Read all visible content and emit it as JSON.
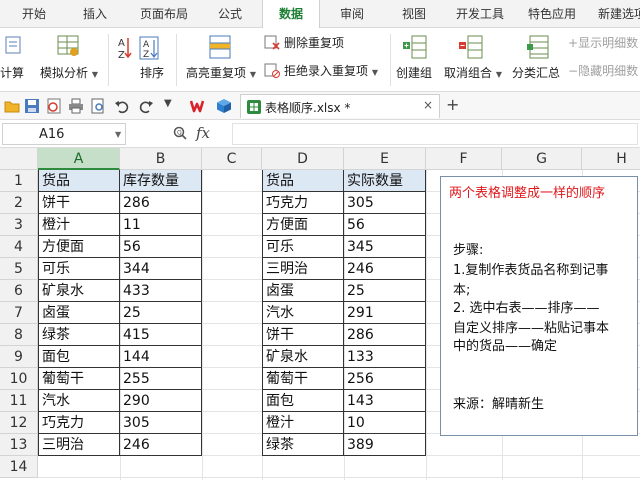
{
  "ribbon_tabs": [
    {
      "label": "开始",
      "active": false
    },
    {
      "label": "插入",
      "active": false
    },
    {
      "label": "页面布局",
      "active": false
    },
    {
      "label": "公式",
      "active": false
    },
    {
      "label": "数据",
      "active": true
    },
    {
      "label": "审阅",
      "active": false
    },
    {
      "label": "视图",
      "active": false
    },
    {
      "label": "开发工具",
      "active": false
    },
    {
      "label": "特色应用",
      "active": false
    },
    {
      "label": "新建选项",
      "active": false
    }
  ],
  "ribbon": {
    "calc_partial": "计算",
    "what_if": "模拟分析",
    "sort": "排序",
    "highlight_dup": "高亮重复项",
    "remove_dup": "删除重复项",
    "reject_dup": "拒绝录入重复项",
    "group": "创建组",
    "ungroup": "取消组合",
    "subtotal": "分类汇总",
    "show_detail": "显示明细数",
    "hide_detail": "隐藏明细数"
  },
  "colors": {
    "accent_green": "#1e7e34",
    "header_fill": "#dde8f5",
    "note_title_red": "#e0181b",
    "wps_red": "#d9232a"
  },
  "file_tab": {
    "name": "表格顺序.xlsx *",
    "close": "×",
    "new_tab": "+"
  },
  "formula_bar": {
    "cell_ref": "A16",
    "fx": "fx",
    "value": ""
  },
  "columns": [
    "A",
    "B",
    "C",
    "D",
    "E",
    "F",
    "G",
    "H"
  ],
  "selected_column": "A",
  "rows": [
    "1",
    "2",
    "3",
    "4",
    "5",
    "6",
    "7",
    "8",
    "9",
    "10",
    "11",
    "12",
    "13",
    "14"
  ],
  "table_left": {
    "headers": [
      "货品",
      "库存数量"
    ],
    "rows": [
      [
        "饼干",
        "286"
      ],
      [
        "橙汁",
        "11"
      ],
      [
        "方便面",
        "56"
      ],
      [
        "可乐",
        "344"
      ],
      [
        "矿泉水",
        "433"
      ],
      [
        "卤蛋",
        "25"
      ],
      [
        "绿茶",
        "415"
      ],
      [
        "面包",
        "144"
      ],
      [
        "葡萄干",
        "255"
      ],
      [
        "汽水",
        "290"
      ],
      [
        "巧克力",
        "305"
      ],
      [
        "三明治",
        "246"
      ]
    ]
  },
  "table_right": {
    "headers": [
      "货品",
      "实际数量"
    ],
    "rows": [
      [
        "巧克力",
        "305"
      ],
      [
        "方便面",
        "56"
      ],
      [
        "可乐",
        "345"
      ],
      [
        "三明治",
        "246"
      ],
      [
        "卤蛋",
        "25"
      ],
      [
        "汽水",
        "291"
      ],
      [
        "饼干",
        "286"
      ],
      [
        "矿泉水",
        "133"
      ],
      [
        "葡萄干",
        "256"
      ],
      [
        "面包",
        "143"
      ],
      [
        "橙汁",
        "10"
      ],
      [
        "绿茶",
        "389"
      ]
    ]
  },
  "note": {
    "title": "两个表格调整成一样的顺序",
    "lines": [
      "步骤:",
      "1.复制作表货品名称到记事",
      "本;",
      "2. 选中右表——排序——",
      "自定义排序——粘贴记事本",
      "中的货品——确定",
      "来源：解晴新生"
    ]
  }
}
